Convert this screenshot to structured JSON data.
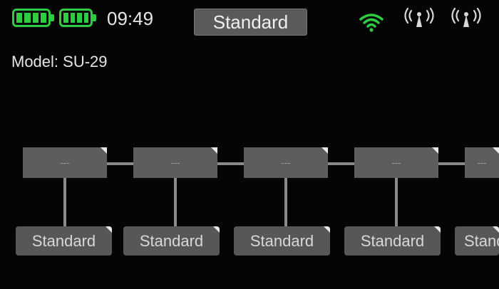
{
  "status_bar": {
    "time": "09:49",
    "mode": "Standard",
    "icons": [
      "battery-icon",
      "battery-icon",
      "wifi-icon",
      "antenna-icon",
      "antenna-icon"
    ],
    "colors": {
      "battery": "#2ecc40",
      "wifi": "#2ecc40"
    }
  },
  "model": {
    "label": "Model: SU-29"
  },
  "chain": {
    "slots": [
      {
        "value": "---",
        "label": "Standard"
      },
      {
        "value": "---",
        "label": "Standard"
      },
      {
        "value": "---",
        "label": "Standard"
      },
      {
        "value": "---",
        "label": "Standard"
      },
      {
        "value": "---",
        "label": "Standard"
      }
    ]
  }
}
